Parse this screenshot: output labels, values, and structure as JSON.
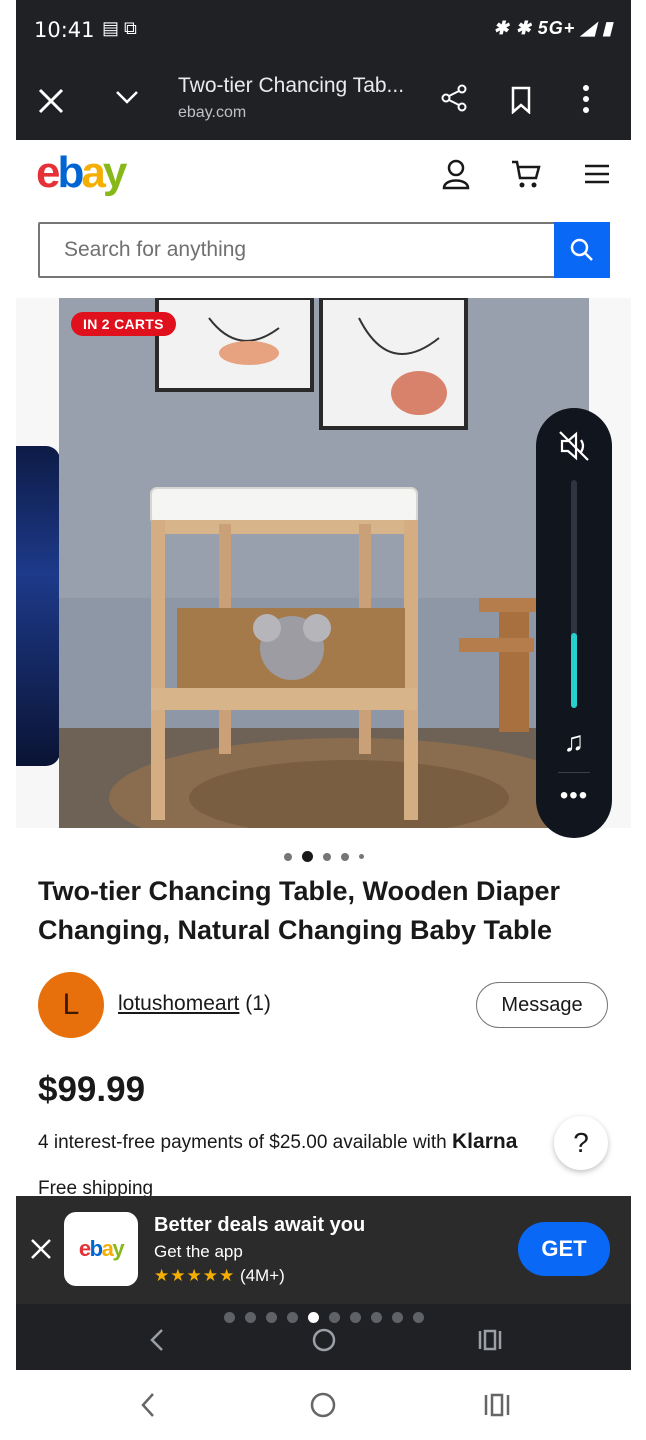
{
  "status_bar": {
    "time": "10:41",
    "network": "5G+"
  },
  "browser_tab": {
    "title": "Two-tier Chancing Tab...",
    "url": "ebay.com"
  },
  "header": {
    "logo": {
      "e": "e",
      "b": "b",
      "a": "a",
      "y": "y"
    },
    "search_placeholder": "Search for anything"
  },
  "gallery": {
    "badge": "IN 2 CARTS",
    "total_images": 5,
    "active_index": 1
  },
  "volume": {
    "level": 0.33
  },
  "product": {
    "title": "Two-tier Chancing Table, Wooden Diaper Changing, Natural Changing Baby Table",
    "seller_initial": "L",
    "seller_name": "lotushomeart",
    "seller_feedback": "(1)",
    "message_label": "Message",
    "price": "$99.99",
    "payments_text": "4 interest-free payments of $25.00 available with ",
    "klarna": "Klarna",
    "help": "?",
    "shipping": "Free shipping"
  },
  "app_banner": {
    "logo": "ebay",
    "title": "Better deals await you",
    "subtitle": "Get the app",
    "stars": "★★★★★",
    "rating_count": "(4M+)",
    "get_label": "GET"
  },
  "pager": {
    "total": 10,
    "active_index": 4
  },
  "colors": {
    "ebay_red": "#e53238",
    "ebay_blue": "#0064d2",
    "ebay_yellow": "#f5af02",
    "ebay_green": "#86b817",
    "accent_blue": "#0968f6",
    "badge_red": "#e0101c",
    "volume_teal": "#25d0cf"
  }
}
